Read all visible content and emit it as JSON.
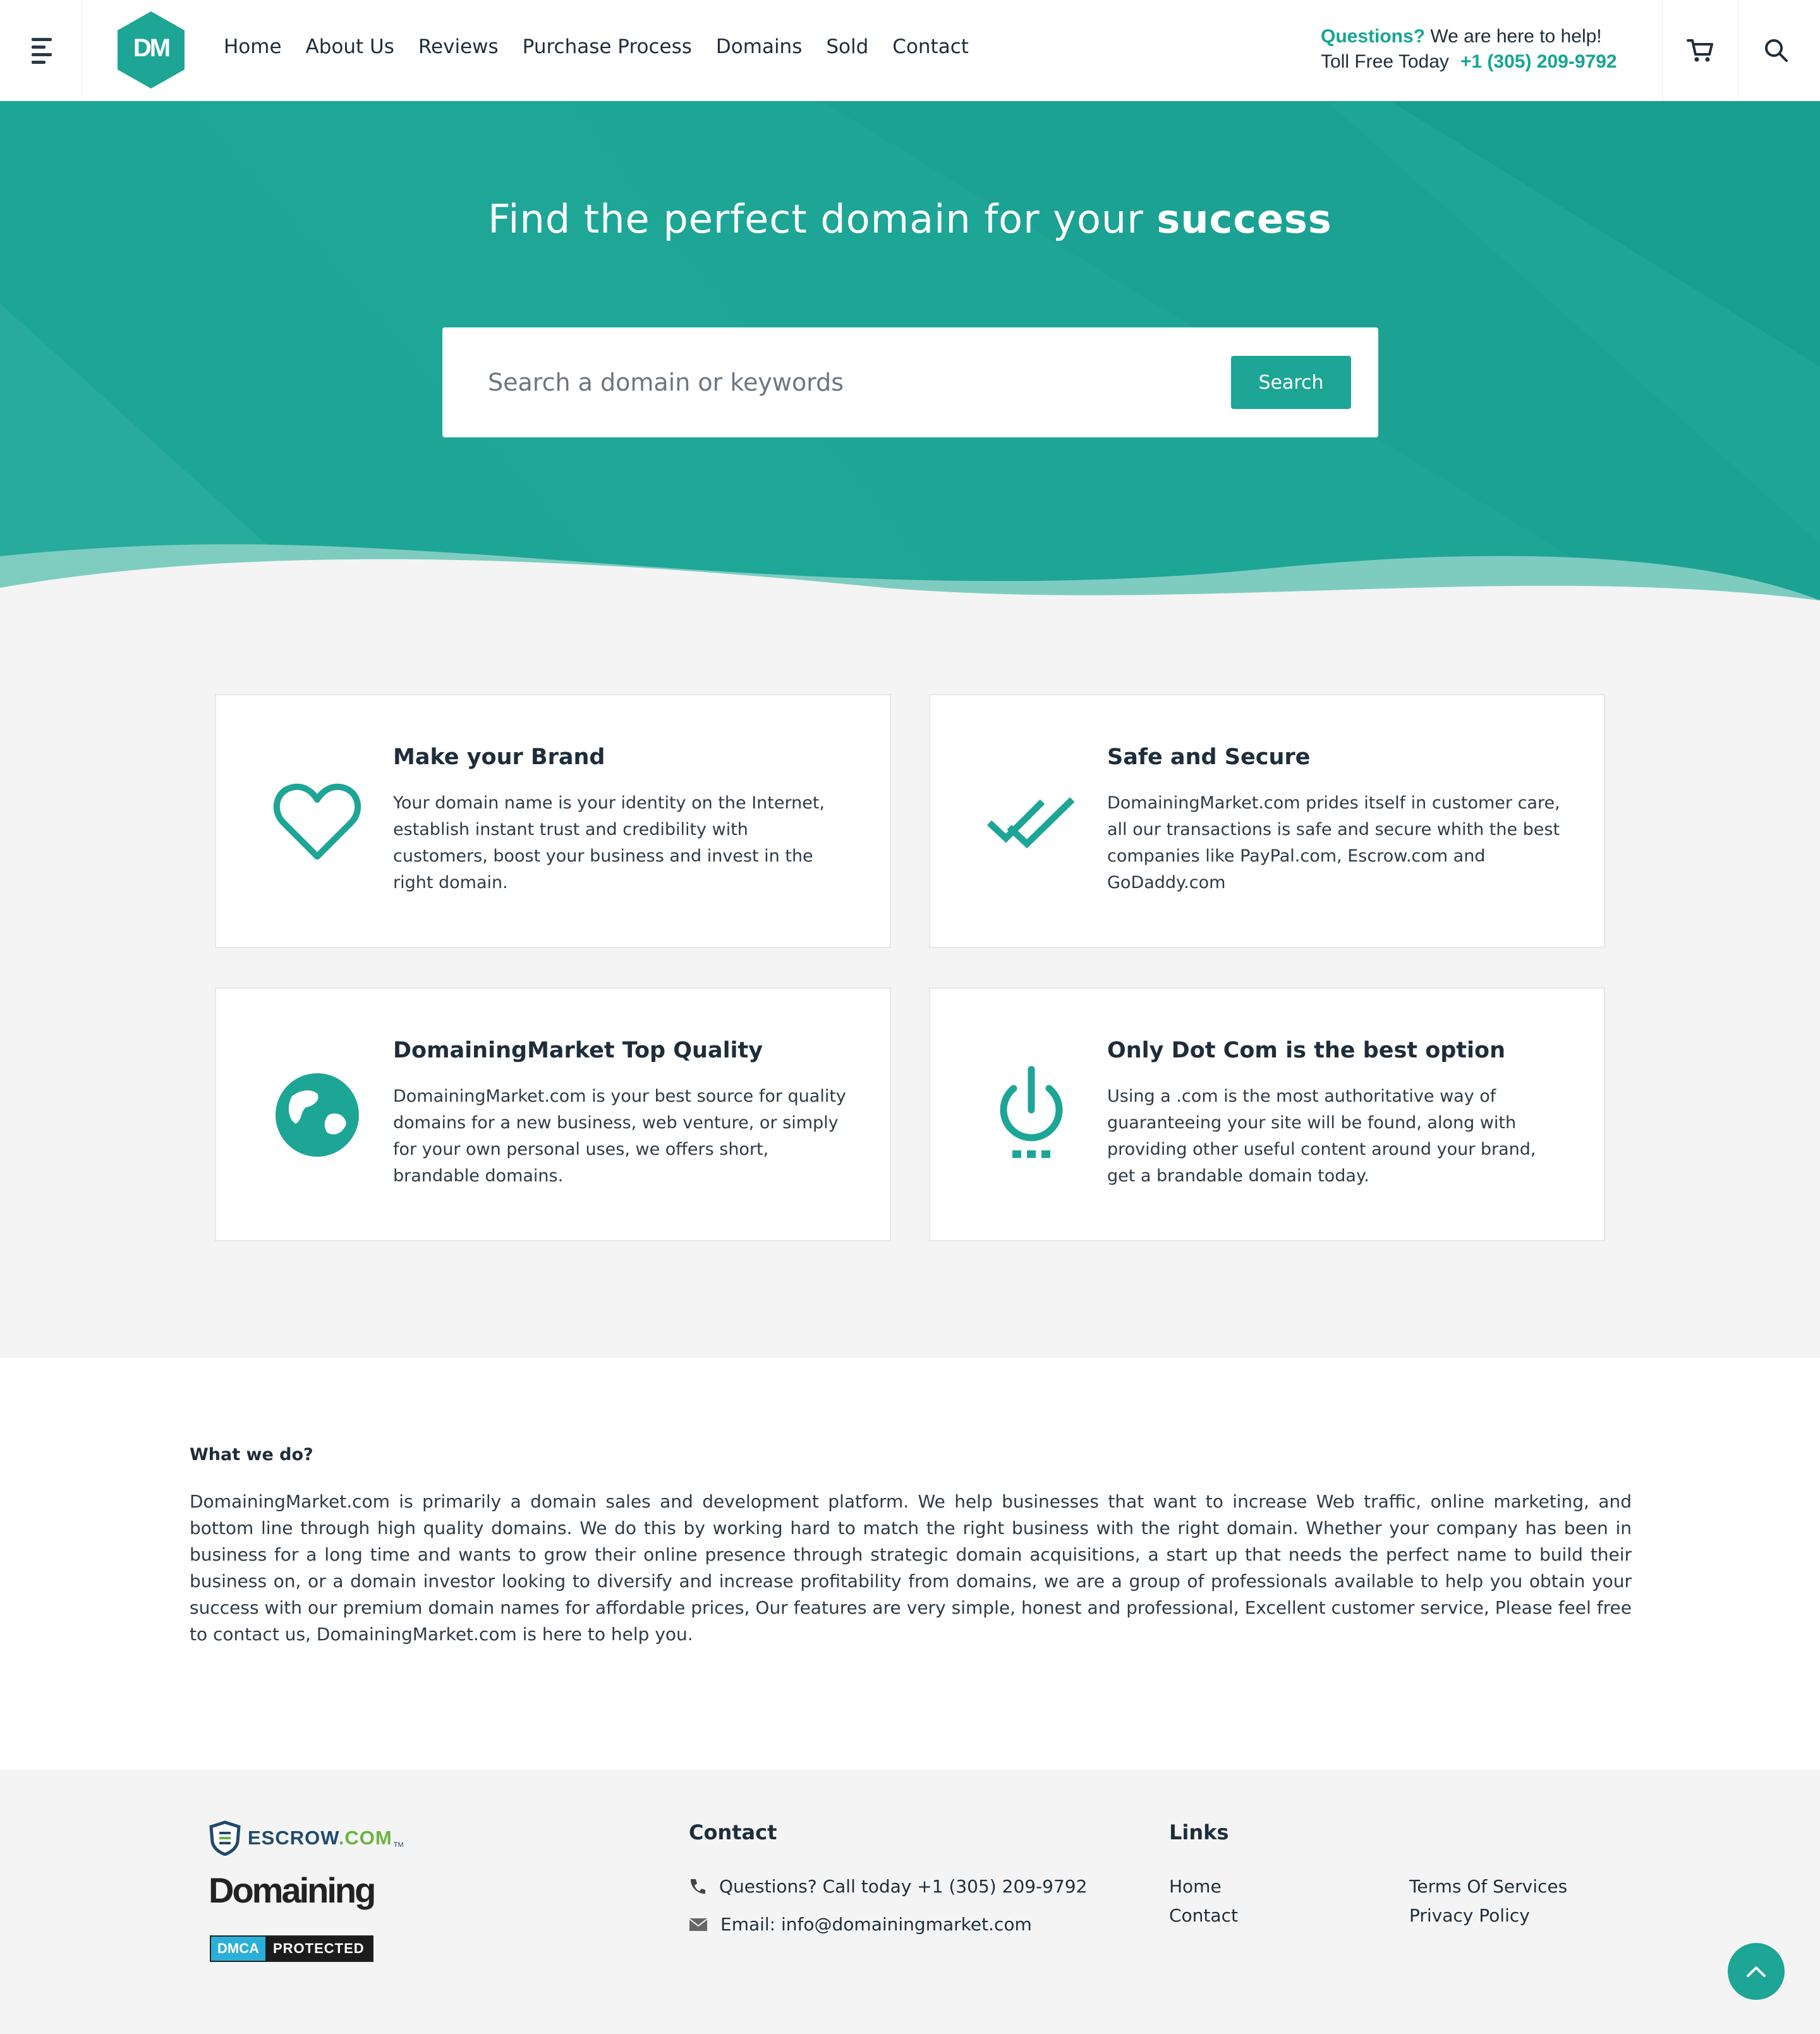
{
  "header": {
    "logo_text": "DM",
    "nav": [
      "Home",
      "About Us",
      "Reviews",
      "Purchase Process",
      "Domains",
      "Sold",
      "Contact"
    ],
    "help_question": "Questions?",
    "help_text": "We are here to help!",
    "toll_free": "Toll Free Today",
    "phone": "+1 (305) 209-9792"
  },
  "hero": {
    "title_main": "Find the perfect domain for your",
    "title_bold": "success",
    "search_placeholder": "Search a domain or keywords",
    "search_button": "Search"
  },
  "features": [
    {
      "icon": "heart-icon",
      "title": "Make your Brand",
      "text": "Your domain name is your identity on the Internet, establish instant trust and credibility with customers, boost your business and invest in the right domain."
    },
    {
      "icon": "double-check-icon",
      "title": "Safe and Secure",
      "text": "DomainingMarket.com prides itself in customer care, all our transactions is safe and secure whith the best companies like PayPal.com, Escrow.com and GoDaddy.com"
    },
    {
      "icon": "globe-icon",
      "title": "DomainingMarket Top Quality",
      "text": "DomainingMarket.com is your best source for quality domains for a new business, web venture, or simply for your own personal uses, we offers short, brandable domains."
    },
    {
      "icon": "power-icon",
      "title": "Only Dot Com is the best option",
      "text": "Using a .com is the most authoritative way of guaranteeing your site will be found, along with providing other useful content around your brand, get a brandable domain today."
    }
  ],
  "about": {
    "heading": "What we do?",
    "text": "DomainingMarket.com is primarily a domain sales and development platform. We help businesses that want to increase Web traffic, online marketing, and bottom line through high quality domains. We do this by working hard to match the right business with the right domain. Whether your company has been in business for a long time and wants to grow their online presence through strategic domain acquisitions, a start up that needs the perfect name to build their business on, or a domain investor looking to diversify and increase profitability from domains, we are a group of professionals available to help you obtain your success with our premium domain names for affordable prices, Our features are very simple, honest and professional, Excellent customer service, Please feel free to contact us, DomainingMarket.com is here to help you."
  },
  "footer": {
    "badges": {
      "escrow_a": "ESCROW",
      "escrow_b": ".COM",
      "escrow_tm": "TM",
      "domaining": "Domaining",
      "dmca_a": "DMCA",
      "dmca_b": "PROTECTED"
    },
    "contact_title": "Contact",
    "contact_phone": "Questions? Call today +1 (305) 209-9792",
    "contact_email": "Email: info@domainingmarket.com",
    "links_title": "Links",
    "links": [
      "Home",
      "Contact",
      "Terms Of Services",
      "Privacy Policy"
    ]
  },
  "colors": {
    "accent": "#1da596",
    "text": "#1f2d3a",
    "footer_bg": "#f4f4f4"
  }
}
